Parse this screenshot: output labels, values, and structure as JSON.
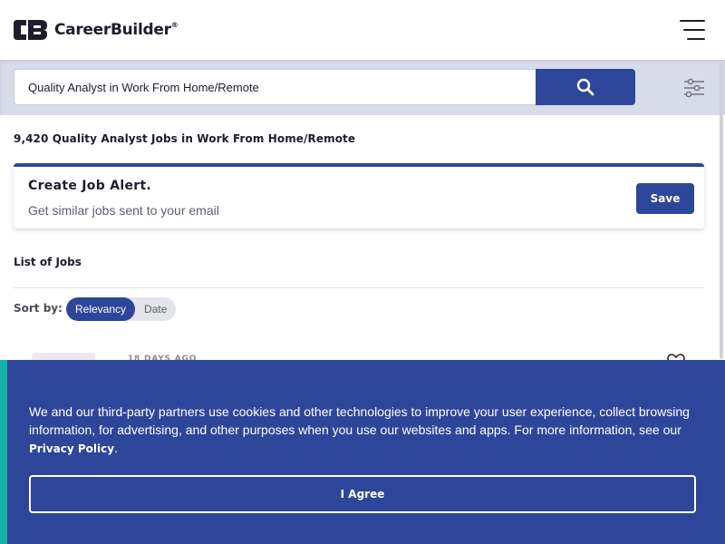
{
  "header": {
    "brand": "CareerBuilder",
    "brand_mark": "®",
    "logo_icon": "careerbuilder-logo-icon",
    "menu_icon": "hamburger-menu-icon"
  },
  "search": {
    "query": "Quality Analyst in Work From Home/Remote",
    "button_icon": "search-icon",
    "filter_icon": "filter-sliders-icon"
  },
  "results": {
    "count_text": "9,420 Quality Analyst Jobs in Work From Home/Remote"
  },
  "job_alert": {
    "title": "Create Job Alert.",
    "subtitle": "Get similar jobs sent to your email",
    "save_label": "Save"
  },
  "jobs": {
    "list_title": "List of Jobs",
    "sort_label": "Sort by:",
    "sort_options": [
      "Relevancy",
      "Date"
    ],
    "selected_sort": "Relevancy",
    "first_job_age": "18 DAYS AGO",
    "favorite_icon": "heart-icon"
  },
  "cookie_banner": {
    "text": "We and our third-party partners use cookies and other technologies to improve your user experience, collect browsing information, for advertising, and other purposes when you use our websites and apps. For more information, see our",
    "policy_link": "Privacy Policy",
    "period": ".",
    "agree_label": "I Agree"
  },
  "colors": {
    "brand_blue": "#2e4699",
    "accent_teal": "#16b3a8",
    "search_band": "#d8dbe9",
    "text_dark": "#1d1d2c"
  }
}
